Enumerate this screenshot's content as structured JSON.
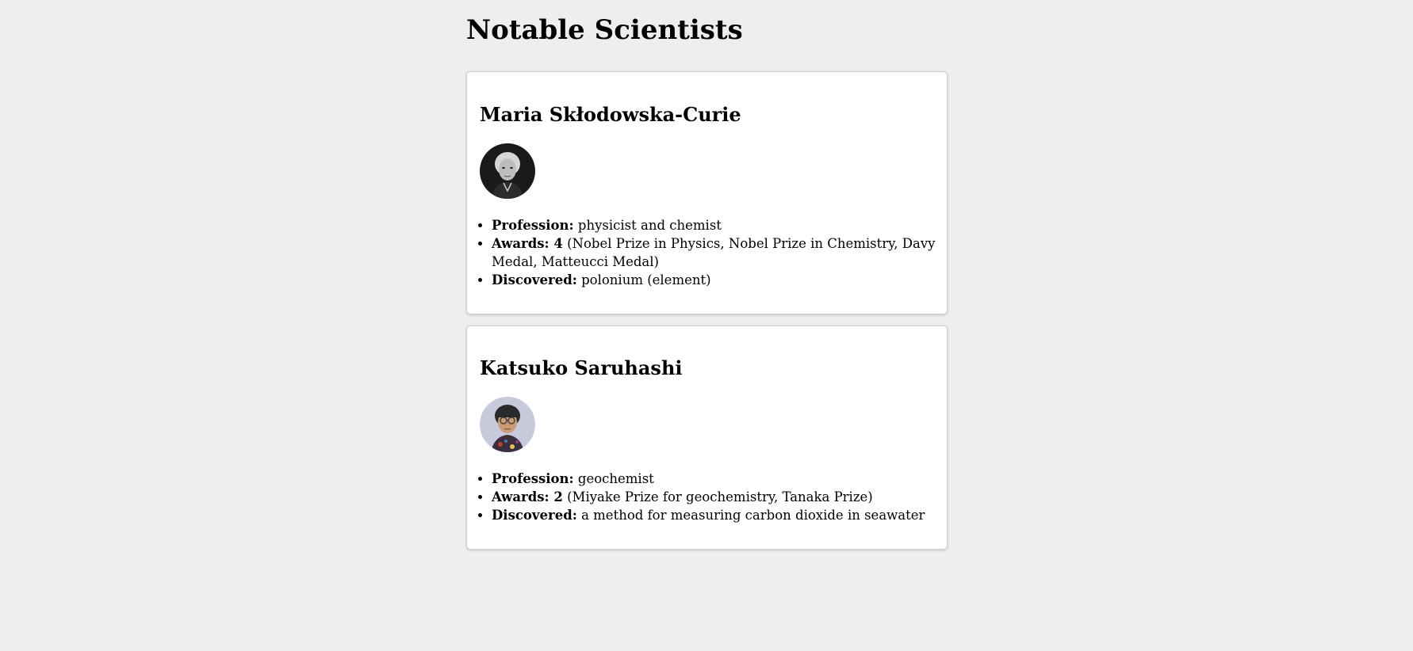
{
  "page": {
    "title": "Notable Scientists"
  },
  "scientists": [
    {
      "name": "Maria Skłodowska-Curie",
      "photo_icon": "portrait-photo",
      "profession_label": "Profession:",
      "profession": "physicist and chemist",
      "awards_label": "Awards: 4",
      "awards_list": "(Nobel Prize in Physics, Nobel Prize in Chemistry, Davy Medal, Matteucci Medal)",
      "discovered_label": "Discovered:",
      "discovered": "polonium (element)"
    },
    {
      "name": "Katsuko Saruhashi",
      "photo_icon": "portrait-photo",
      "profession_label": "Profession:",
      "profession": "geochemist",
      "awards_label": "Awards: 2",
      "awards_list": "(Miyake Prize for geochemistry, Tanaka Prize)",
      "discovered_label": "Discovered:",
      "discovered": "a method for measuring carbon dioxide in seawater"
    }
  ]
}
